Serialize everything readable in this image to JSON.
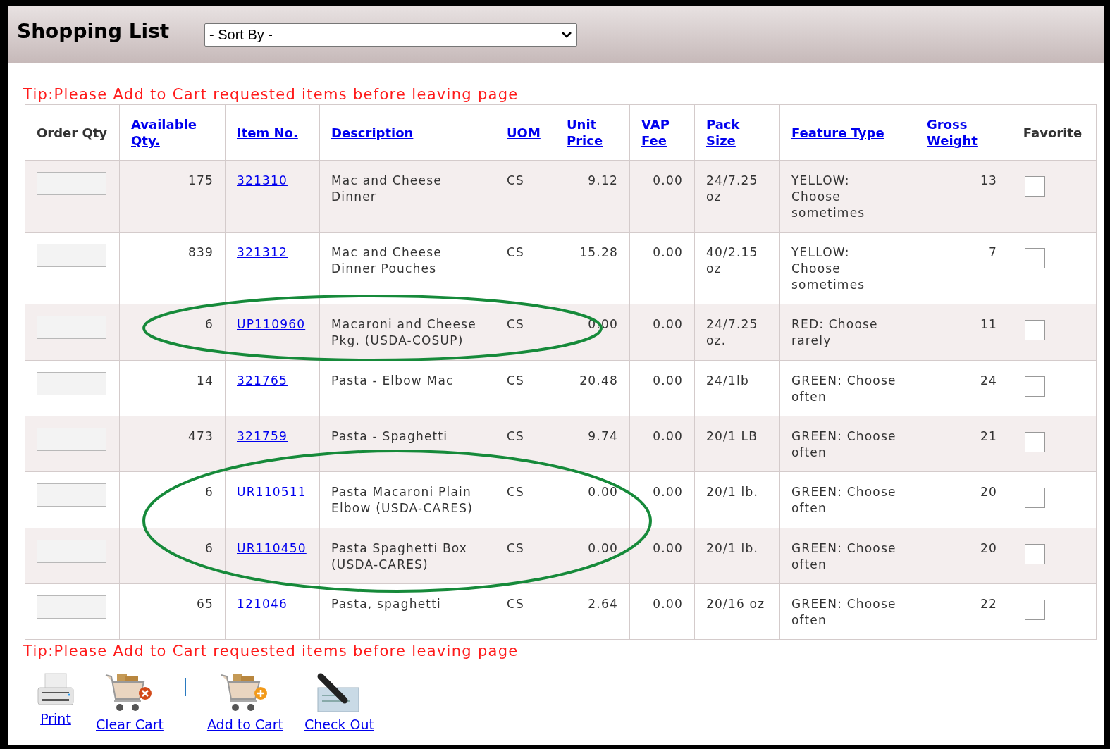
{
  "header": {
    "title": "Shopping List",
    "sort_select": {
      "value": "- Sort By -"
    }
  },
  "tip_top": "Tip:Please Add to Cart requested items before leaving page",
  "table": {
    "columns": [
      {
        "label": "Order Qty",
        "link": false
      },
      {
        "label": "Available Qty.",
        "link": true
      },
      {
        "label": "Item No.",
        "link": true
      },
      {
        "label": "Description",
        "link": true
      },
      {
        "label": "UOM",
        "link": true
      },
      {
        "label": "Unit Price",
        "link": true
      },
      {
        "label": "VAP Fee",
        "link": true
      },
      {
        "label": "Pack Size",
        "link": true
      },
      {
        "label": "Feature Type",
        "link": true
      },
      {
        "label": "Gross Weight",
        "link": true
      },
      {
        "label": "Favorite",
        "link": false
      }
    ],
    "rows": [
      {
        "available": "175",
        "item_no": "321310",
        "description": "Mac and Cheese Dinner",
        "uom": "CS",
        "unit_price": "9.12",
        "vap_fee": "0.00",
        "pack_size": "24/7.25 oz",
        "feature_type": "YELLOW: Choose sometimes",
        "gross_weight": "13",
        "favorite": false,
        "highlighted": false
      },
      {
        "available": "839",
        "item_no": "321312",
        "description": "Mac and Cheese Dinner Pouches",
        "uom": "CS",
        "unit_price": "15.28",
        "vap_fee": "0.00",
        "pack_size": "40/2.15 oz",
        "feature_type": "YELLOW: Choose sometimes",
        "gross_weight": "7",
        "favorite": false,
        "highlighted": false
      },
      {
        "available": "6",
        "item_no": "UP110960",
        "description": "Macaroni and Cheese Pkg. (USDA-COSUP)",
        "uom": "CS",
        "unit_price": "0.00",
        "vap_fee": "0.00",
        "pack_size": "24/7.25 oz.",
        "feature_type": "RED: Choose rarely",
        "gross_weight": "11",
        "favorite": false,
        "highlighted": true
      },
      {
        "available": "14",
        "item_no": "321765",
        "description": "Pasta - Elbow Mac",
        "uom": "CS",
        "unit_price": "20.48",
        "vap_fee": "0.00",
        "pack_size": "24/1lb",
        "feature_type": "GREEN: Choose often",
        "gross_weight": "24",
        "favorite": false,
        "highlighted": false
      },
      {
        "available": "473",
        "item_no": "321759",
        "description": "Pasta - Spaghetti",
        "uom": "CS",
        "unit_price": "9.74",
        "vap_fee": "0.00",
        "pack_size": "20/1 LB",
        "feature_type": "GREEN: Choose often",
        "gross_weight": "21",
        "favorite": false,
        "highlighted": false
      },
      {
        "available": "6",
        "item_no": "UR110511",
        "description": "Pasta Macaroni Plain Elbow (USDA-CARES)",
        "uom": "CS",
        "unit_price": "0.00",
        "vap_fee": "0.00",
        "pack_size": "20/1 lb.",
        "feature_type": "GREEN: Choose often",
        "gross_weight": "20",
        "favorite": false,
        "highlighted": true
      },
      {
        "available": "6",
        "item_no": "UR110450",
        "description": "Pasta Spaghetti Box (USDA-CARES)",
        "uom": "CS",
        "unit_price": "0.00",
        "vap_fee": "0.00",
        "pack_size": "20/1 lb.",
        "feature_type": "GREEN: Choose often",
        "gross_weight": "20",
        "favorite": false,
        "highlighted": true
      },
      {
        "available": "65",
        "item_no": "121046",
        "description": "Pasta, spaghetti",
        "uom": "CS",
        "unit_price": "2.64",
        "vap_fee": "0.00",
        "pack_size": "20/16 oz",
        "feature_type": "GREEN: Choose often",
        "gross_weight": "22",
        "favorite": false,
        "highlighted": false
      }
    ]
  },
  "tip_bottom": "Tip:Please Add to Cart requested items before leaving page",
  "actions": [
    {
      "kind": "print",
      "label": "Print"
    },
    {
      "kind": "clear",
      "label": "Clear Cart"
    },
    {
      "kind": "separator"
    },
    {
      "kind": "add",
      "label": "Add to Cart"
    },
    {
      "kind": "checkout",
      "label": "Check Out"
    }
  ]
}
